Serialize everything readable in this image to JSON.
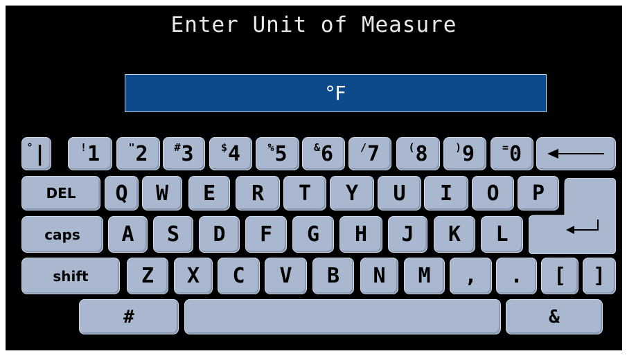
{
  "title": "Enter Unit of Measure",
  "input": {
    "value": "°F"
  },
  "keyboard": {
    "row1": [
      {
        "sup": "°",
        "main": "|"
      },
      {
        "sup": "!",
        "main": "1"
      },
      {
        "sup": "\"",
        "main": "2"
      },
      {
        "sup": "#",
        "main": "3"
      },
      {
        "sup": "$",
        "main": "4"
      },
      {
        "sup": "%",
        "main": "5"
      },
      {
        "sup": "&",
        "main": "6"
      },
      {
        "sup": "/",
        "main": "7"
      },
      {
        "sup": "(",
        "main": "8"
      },
      {
        "sup": ")",
        "main": "9"
      },
      {
        "sup": "=",
        "main": "0"
      }
    ],
    "row2": {
      "del": "DEL",
      "keys": [
        "Q",
        "W",
        "E",
        "R",
        "T",
        "Y",
        "U",
        "I",
        "O",
        "P"
      ]
    },
    "row3": {
      "caps": "caps",
      "keys": [
        "A",
        "S",
        "D",
        "F",
        "G",
        "H",
        "J",
        "K",
        "L"
      ]
    },
    "row4": {
      "shift": "shift",
      "keys": [
        "Z",
        "X",
        "C",
        "V",
        "B",
        "N",
        "M",
        ",",
        ".",
        "[",
        "]"
      ]
    },
    "row5": {
      "left": "#",
      "right": "&"
    },
    "backspace_icon": "backspace-arrow-icon",
    "enter_icon": "enter-return-icon"
  },
  "colors": {
    "screen": "#000000",
    "field": "#0c4a8c",
    "key": "#a9b8cf",
    "title": "#e9e9e9"
  }
}
